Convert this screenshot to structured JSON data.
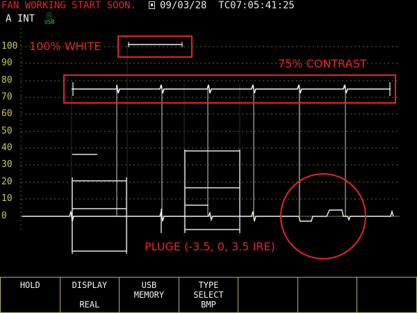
{
  "status_bar": {
    "warning": "FAN WORKING START SOON.",
    "storage_icon": "sd-card-icon",
    "datetime": "09/03/28  TC07:05:41:25"
  },
  "input": {
    "label": "A  INT",
    "usb_icon": "usb-icon",
    "usb_text": "USB"
  },
  "scale": {
    "labels": [
      "100",
      "90",
      "80",
      "70",
      "60",
      "50",
      "40",
      "30",
      "20",
      "10",
      "0"
    ],
    "color": "#c9c95a"
  },
  "annotations": {
    "white_label": "100% WHITE",
    "contrast_label": "75%  CONTRAST",
    "pluge_label": "PLUGE (-3.5, 0, 3.5 IRE)",
    "color": "#e8232a"
  },
  "softkeys": [
    {
      "line1": "HOLD",
      "line2": "",
      "line3": ""
    },
    {
      "line1": "DISPLAY",
      "line2": "",
      "line3": "REAL"
    },
    {
      "line1": "USB",
      "line2": "MEMORY",
      "line3": ""
    },
    {
      "line1": "TYPE",
      "line2": "SELECT",
      "line3": "BMP"
    },
    {
      "line1": "",
      "line2": "",
      "line3": ""
    },
    {
      "line1": "",
      "line2": "",
      "line3": ""
    },
    {
      "line1": "",
      "line2": "",
      "line3": ""
    }
  ]
}
